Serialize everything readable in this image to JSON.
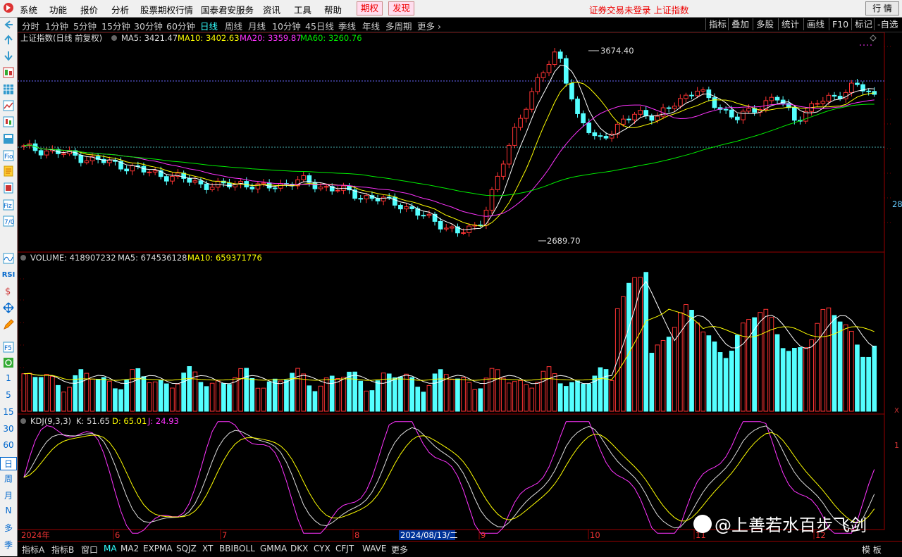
{
  "menu": {
    "items": [
      "系统",
      "功能",
      "报价",
      "分析",
      "股票期权行情",
      "国泰君安服务",
      "资讯",
      "工具",
      "帮助"
    ],
    "highlight_items": [
      "期权",
      "发现"
    ],
    "status_title": "证券交易未登录 上证指数",
    "quote_button": "行 情"
  },
  "sidebar": {
    "labels": [
      "RSI",
      "1",
      "5",
      "15",
      "30",
      "60",
      "日",
      "周",
      "月",
      "N",
      "多",
      "季"
    ]
  },
  "toolbar": {
    "periods": [
      "分时",
      "1分钟",
      "5分钟",
      "15分钟",
      "30分钟",
      "60分钟",
      "日线",
      "周线",
      "月线",
      "10分钟",
      "45日线",
      "季线",
      "年线",
      "多周期",
      "更多 ›"
    ],
    "active_period": "日线",
    "right_items": [
      "指标",
      "叠加",
      "多股",
      "统计",
      "画线",
      "F10",
      "标记",
      "-自选"
    ]
  },
  "price_panel": {
    "title": "上证指数(日线 前复权)",
    "ma5_label": "MA5: 3421.47",
    "ma10_label": "MA10: 3402.63",
    "ma20_label": "MA20: 3359.87",
    "ma60_label": "MA60: 3260.76",
    "high_label": "3674.40",
    "low_label": "2689.70",
    "right_axis_label": "28",
    "colors": {
      "up": "#ff3333",
      "down": "#54ffff",
      "ma5": "#ffffff",
      "ma10": "#ffff00",
      "ma20": "#ff33ff",
      "ma60": "#00ee00"
    }
  },
  "volume_panel": {
    "title": "VOLUME: 418907232",
    "ma5_label": "MA5: 674536128",
    "ma10_label": "MA10: 659371776"
  },
  "kdj_panel": {
    "title": "KDJ(9,3,3)",
    "k_label": "K: 51.65",
    "d_label": "D: 65.01",
    "j_label": "J: 24.93",
    "right_axis_label": "1"
  },
  "date_axis": {
    "labels": [
      "2024年",
      "6",
      "7",
      "8",
      "2024/08/13/二",
      "9",
      "10",
      "11",
      "12"
    ]
  },
  "bottombar": {
    "items": [
      "指标A",
      "指标B",
      "窗口",
      "MA",
      "MA2",
      "EXPMA",
      "SQJZ",
      "XT",
      "BBIBOLL",
      "GMMA",
      "DKX",
      "CYX",
      "CFJT",
      "WAVE",
      "更多"
    ],
    "active_item": "MA",
    "right_label": "模 板"
  },
  "watermark": "@上善若水百步飞剑",
  "chart_data": {
    "type": "candlestick",
    "title": "上证指数(日线 前复权)",
    "x": [
      "2024-05",
      "2024-06",
      "2024-07",
      "2024-08",
      "2024-09",
      "2024-10",
      "2024-11",
      "2024-12"
    ],
    "close_series": [
      3150,
      3140,
      3120,
      3100,
      3080,
      3060,
      3030,
      3010,
      2990,
      2960,
      2950,
      2970,
      2940,
      2960,
      2980,
      2950,
      2930,
      2900,
      2880,
      2860,
      2800,
      2760,
      2700,
      2750,
      3000,
      3300,
      3500,
      3670,
      3300,
      3200,
      3250,
      3350,
      3300,
      3400,
      3450,
      3380,
      3300,
      3360,
      3420,
      3300,
      3380,
      3420,
      3480,
      3421
    ],
    "volume_ma5": 674536128,
    "volume_ma10": 659371776,
    "kdj": {
      "k": 51.65,
      "d": 65.01,
      "j": 24.93
    }
  }
}
